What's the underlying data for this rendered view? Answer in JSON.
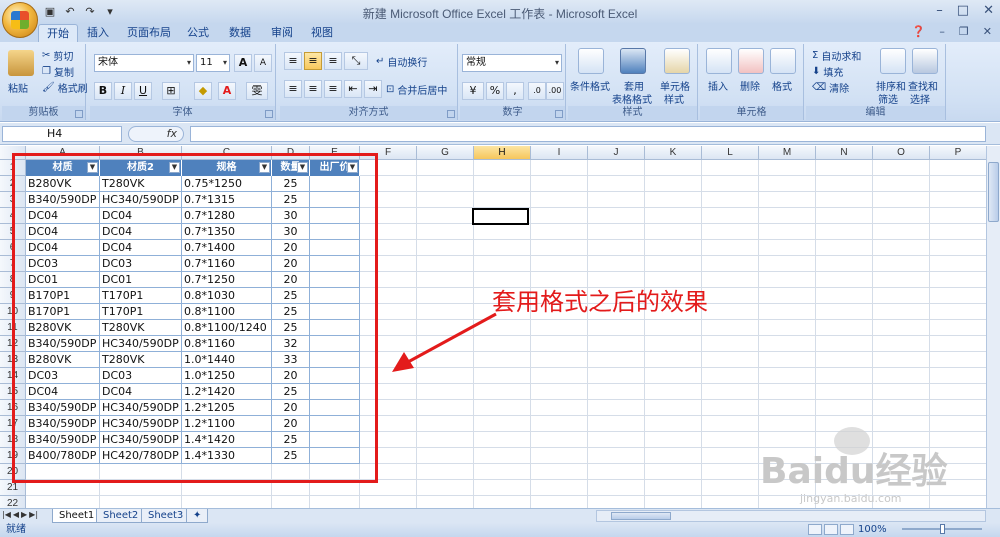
{
  "window": {
    "title": "新建 Microsoft Office Excel 工作表 - Microsoft Excel",
    "controls": [
      "–",
      "□",
      "✕"
    ]
  },
  "tabs": [
    "开始",
    "插入",
    "页面布局",
    "公式",
    "数据",
    "审阅",
    "视图"
  ],
  "ribbon": {
    "clipboard": {
      "label": "剪贴板",
      "paste": "粘贴",
      "cut": "剪切",
      "copy": "复制",
      "format_painter": "格式刷"
    },
    "font": {
      "label": "字体",
      "font_name": "宋体",
      "font_size": "11",
      "grow": "A",
      "shrink": "A",
      "bold": "B",
      "italic": "I",
      "underline": "U",
      "phonetic": "雯"
    },
    "alignment": {
      "label": "对齐方式",
      "wrap": "自动换行",
      "merge": "合并后居中"
    },
    "number": {
      "label": "数字",
      "format": "常规",
      "percent": "%",
      "comma": ","
    },
    "styles": {
      "label": "样式",
      "conditional": "条件格式",
      "table_format_1": "套用",
      "table_format_2": "表格格式",
      "cell_style_1": "单元格",
      "cell_style_2": "样式"
    },
    "cells": {
      "label": "单元格",
      "insert": "插入",
      "delete": "删除",
      "format": "格式"
    },
    "editing": {
      "label": "编辑",
      "autosum": "自动求和",
      "fill": "填充",
      "clear": "清除",
      "sort_1": "排序和",
      "sort_2": "筛选",
      "find_1": "查找和",
      "find_2": "选择"
    }
  },
  "formula_bar": {
    "name_box": "H4",
    "fx": "fx",
    "content": ""
  },
  "columns": [
    "A",
    "B",
    "C",
    "D",
    "E",
    "F",
    "G",
    "H",
    "I",
    "J",
    "K",
    "L",
    "M",
    "N",
    "O",
    "P"
  ],
  "rows": [
    "1",
    "2",
    "3",
    "4",
    "5",
    "6",
    "7",
    "8",
    "9",
    "10",
    "11",
    "12",
    "13",
    "14",
    "15",
    "16",
    "17",
    "18",
    "19",
    "20",
    "21",
    "22"
  ],
  "table": {
    "headers": [
      "材质",
      "材质2",
      "规格",
      "数量",
      "出厂价"
    ],
    "rows": [
      [
        "B280VK",
        "T280VK",
        "0.75*1250",
        "25",
        ""
      ],
      [
        "B340/590DP",
        "HC340/590DP",
        "0.7*1315",
        "25",
        ""
      ],
      [
        "DC04",
        "DC04",
        "0.7*1280",
        "30",
        ""
      ],
      [
        "DC04",
        "DC04",
        "0.7*1350",
        "30",
        ""
      ],
      [
        "DC04",
        "DC04",
        "0.7*1400",
        "20",
        ""
      ],
      [
        "DC03",
        "DC03",
        "0.7*1160",
        "20",
        ""
      ],
      [
        "DC01",
        "DC01",
        "0.7*1250",
        "20",
        ""
      ],
      [
        "B170P1",
        "T170P1",
        "0.8*1030",
        "25",
        ""
      ],
      [
        "B170P1",
        "T170P1",
        "0.8*1100",
        "25",
        ""
      ],
      [
        "B280VK",
        "T280VK",
        "0.8*1100/1240",
        "25",
        ""
      ],
      [
        "B340/590DP",
        "HC340/590DP",
        "0.8*1160",
        "32",
        ""
      ],
      [
        "B280VK",
        "T280VK",
        "1.0*1440",
        "33",
        ""
      ],
      [
        "DC03",
        "DC03",
        "1.0*1250",
        "20",
        ""
      ],
      [
        "DC04",
        "DC04",
        "1.2*1420",
        "25",
        ""
      ],
      [
        "B340/590DP",
        "HC340/590DP",
        "1.2*1205",
        "20",
        ""
      ],
      [
        "B340/590DP",
        "HC340/590DP",
        "1.2*1100",
        "20",
        ""
      ],
      [
        "B340/590DP",
        "HC340/590DP",
        "1.4*1420",
        "25",
        ""
      ],
      [
        "B400/780DP",
        "HC420/780DP",
        "1.4*1330",
        "25",
        ""
      ]
    ]
  },
  "annotation": "套用格式之后的效果",
  "sheets": [
    "Sheet1",
    "Sheet2",
    "Sheet3"
  ],
  "status": {
    "ready": "就绪",
    "zoom": "100%"
  },
  "watermark": {
    "brand": "Baidu经验",
    "url": "jingyan.baidu.com"
  },
  "colors": {
    "accent_red": "#e31b1b",
    "table_header": "#4f81bd",
    "ribbon_bg": "#d2e1f4"
  }
}
